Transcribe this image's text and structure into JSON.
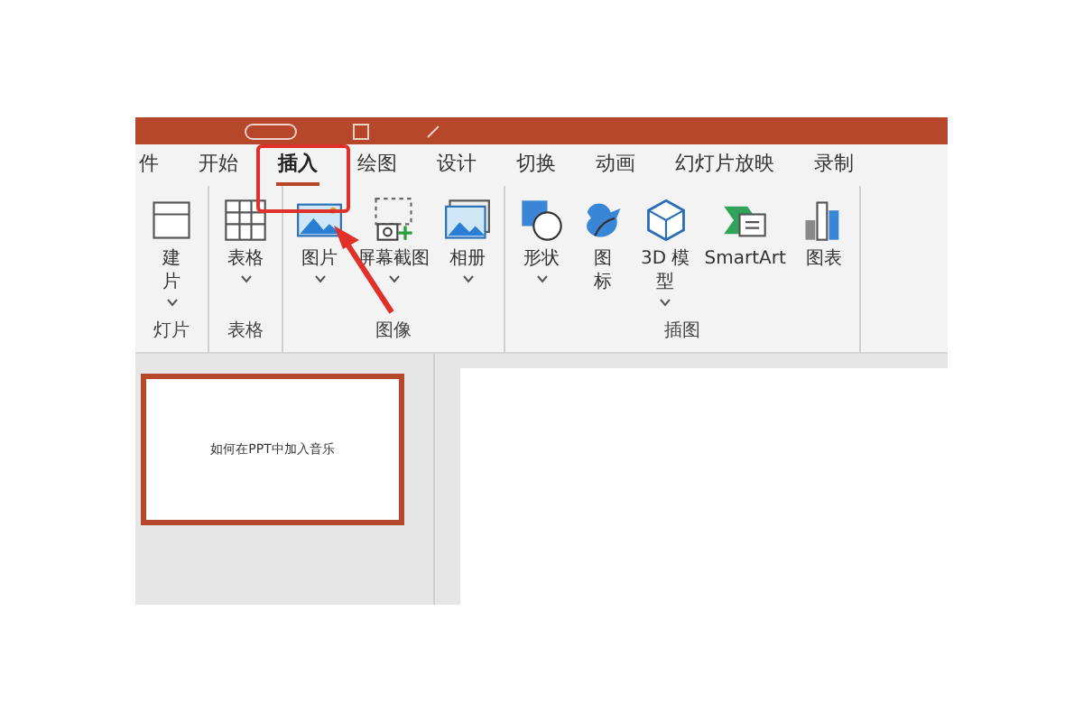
{
  "tabs": [
    {
      "label": "件",
      "selected": false
    },
    {
      "label": "开始",
      "selected": false
    },
    {
      "label": "插入",
      "selected": true
    },
    {
      "label": "绘图",
      "selected": false
    },
    {
      "label": "设计",
      "selected": false
    },
    {
      "label": "切换",
      "selected": false
    },
    {
      "label": "动画",
      "selected": false
    },
    {
      "label": "幻灯片放映",
      "selected": false
    },
    {
      "label": "录制",
      "selected": false
    }
  ],
  "ribbon": {
    "groups": [
      {
        "label": "灯片",
        "buttons": [
          {
            "lines": [
              "建",
              "片"
            ],
            "caret": true
          }
        ]
      },
      {
        "label": "表格",
        "buttons": [
          {
            "lines": [
              "表格"
            ],
            "caret": true
          }
        ]
      },
      {
        "label": "图像",
        "buttons": [
          {
            "lines": [
              "图片"
            ],
            "caret": true
          },
          {
            "lines": [
              "屏幕截图"
            ],
            "caret": true
          },
          {
            "lines": [
              "相册"
            ],
            "caret": true
          }
        ]
      },
      {
        "label": "插图",
        "buttons": [
          {
            "lines": [
              "形状"
            ],
            "caret": true
          },
          {
            "lines": [
              "图",
              "标"
            ],
            "caret": false
          },
          {
            "lines": [
              "3D 模",
              "型"
            ],
            "caret": true
          },
          {
            "lines": [
              "SmartArt"
            ],
            "caret": false
          },
          {
            "lines": [
              "图表"
            ],
            "caret": false
          }
        ]
      }
    ]
  },
  "thumbnails": [
    {
      "text": "如何在PPT中加入音乐",
      "selected": true
    }
  ]
}
